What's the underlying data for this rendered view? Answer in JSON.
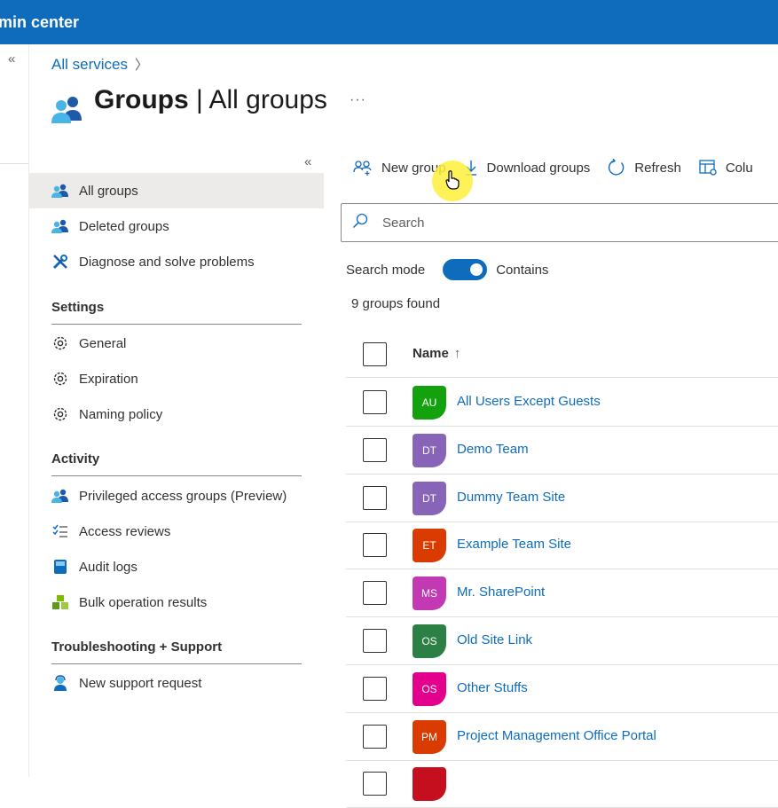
{
  "header": {
    "title": "min center",
    "color": "#0f6cbd"
  },
  "breadcrumb": {
    "link": "All services"
  },
  "page": {
    "title_bold": "Groups",
    "title_sep": " | ",
    "title_rest": "All groups",
    "more": "···"
  },
  "nav": {
    "items": [
      {
        "label": "All groups"
      },
      {
        "label": "Deleted groups"
      },
      {
        "label": "Diagnose and solve problems"
      }
    ],
    "settings_title": "Settings",
    "settings_items": [
      {
        "label": "General"
      },
      {
        "label": "Expiration"
      },
      {
        "label": "Naming policy"
      }
    ],
    "activity_title": "Activity",
    "activity_items": [
      {
        "label": "Privileged access groups (Preview)"
      },
      {
        "label": "Access reviews"
      },
      {
        "label": "Audit logs"
      },
      {
        "label": "Bulk operation results"
      }
    ],
    "support_title": "Troubleshooting + Support",
    "support_items": [
      {
        "label": "New support request"
      }
    ]
  },
  "toolbar": {
    "new_group": "New group",
    "download": "Download groups",
    "refresh": "Refresh",
    "columns": "Colu"
  },
  "search": {
    "placeholder": "Search"
  },
  "search_mode": {
    "label": "Search mode",
    "value": "Contains",
    "on": true
  },
  "results": {
    "count_text": "9 groups found"
  },
  "grid": {
    "name_header": "Name",
    "sort_arrow": "↑",
    "rows": [
      {
        "initials": "AU",
        "name": "All Users Except Guests",
        "color": "#13a10e"
      },
      {
        "initials": "DT",
        "name": "Demo Team",
        "color": "#8764b8"
      },
      {
        "initials": "DT",
        "name": "Dummy Team Site",
        "color": "#8764b8"
      },
      {
        "initials": "ET",
        "name": "Example Team Site",
        "color": "#da3b01"
      },
      {
        "initials": "MS",
        "name": "Mr. SharePoint",
        "color": "#c239b3"
      },
      {
        "initials": "OS",
        "name": "Old Site Link",
        "color": "#2d8045"
      },
      {
        "initials": "OS",
        "name": "Other Stuffs",
        "color": "#e3008c"
      },
      {
        "initials": "PM",
        "name": "Project Management Office Portal",
        "color": "#da3b01"
      },
      {
        "initials": "",
        "name": "",
        "color": "#c50f1f"
      }
    ]
  },
  "icons": {
    "groups": "people-icon",
    "diagnose": "wrench-icon",
    "settings": "gear-icon",
    "reviews": "checklist-icon",
    "audit": "book-icon",
    "bulk": "cubes-icon",
    "support": "support-agent-icon"
  }
}
